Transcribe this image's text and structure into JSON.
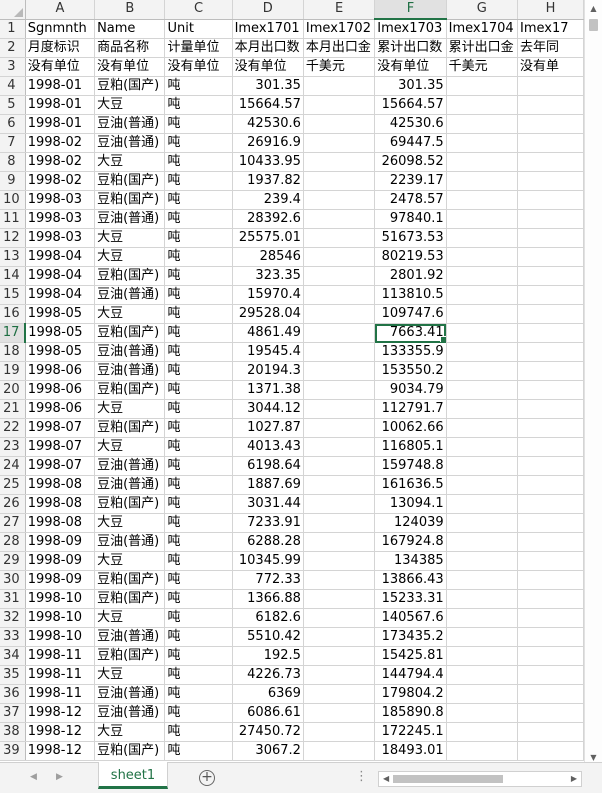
{
  "columns": [
    "A",
    "B",
    "C",
    "D",
    "E",
    "F",
    "G",
    "H"
  ],
  "selected_column": "F",
  "selected_row": 17,
  "active_cell": "F17",
  "rows": [
    {
      "r": 1,
      "A": "Sgnmnth",
      "B": "Name",
      "C": "Unit",
      "D": "Imex1701",
      "E": "Imex1702",
      "F": "Imex1703",
      "G": "Imex1704",
      "H": "Imex17"
    },
    {
      "r": 2,
      "A": "月度标识",
      "B": "商品名称",
      "C": "计量单位",
      "D": "本月出口数",
      "E": "本月出口金",
      "F": "累计出口数",
      "G": "累计出口金",
      "H": "去年同"
    },
    {
      "r": 3,
      "A": "没有单位",
      "B": "没有单位",
      "C": "没有单位",
      "D": "没有单位",
      "E": "千美元",
      "F": "没有单位",
      "G": "千美元",
      "H": "没有单"
    },
    {
      "r": 4,
      "A": "1998-01",
      "B": "豆粕(国产)",
      "C": "吨",
      "D": "301.35",
      "E": "",
      "F": "301.35",
      "G": "",
      "H": ""
    },
    {
      "r": 5,
      "A": "1998-01",
      "B": "大豆",
      "C": "吨",
      "D": "15664.57",
      "E": "",
      "F": "15664.57",
      "G": "",
      "H": ""
    },
    {
      "r": 6,
      "A": "1998-01",
      "B": "豆油(普通)",
      "C": "吨",
      "D": "42530.6",
      "E": "",
      "F": "42530.6",
      "G": "",
      "H": ""
    },
    {
      "r": 7,
      "A": "1998-02",
      "B": "豆油(普通)",
      "C": "吨",
      "D": "26916.9",
      "E": "",
      "F": "69447.5",
      "G": "",
      "H": ""
    },
    {
      "r": 8,
      "A": "1998-02",
      "B": "大豆",
      "C": "吨",
      "D": "10433.95",
      "E": "",
      "F": "26098.52",
      "G": "",
      "H": ""
    },
    {
      "r": 9,
      "A": "1998-02",
      "B": "豆粕(国产)",
      "C": "吨",
      "D": "1937.82",
      "E": "",
      "F": "2239.17",
      "G": "",
      "H": ""
    },
    {
      "r": 10,
      "A": "1998-03",
      "B": "豆粕(国产)",
      "C": "吨",
      "D": "239.4",
      "E": "",
      "F": "2478.57",
      "G": "",
      "H": ""
    },
    {
      "r": 11,
      "A": "1998-03",
      "B": "豆油(普通)",
      "C": "吨",
      "D": "28392.6",
      "E": "",
      "F": "97840.1",
      "G": "",
      "H": ""
    },
    {
      "r": 12,
      "A": "1998-03",
      "B": "大豆",
      "C": "吨",
      "D": "25575.01",
      "E": "",
      "F": "51673.53",
      "G": "",
      "H": ""
    },
    {
      "r": 13,
      "A": "1998-04",
      "B": "大豆",
      "C": "吨",
      "D": "28546",
      "E": "",
      "F": "80219.53",
      "G": "",
      "H": ""
    },
    {
      "r": 14,
      "A": "1998-04",
      "B": "豆粕(国产)",
      "C": "吨",
      "D": "323.35",
      "E": "",
      "F": "2801.92",
      "G": "",
      "H": ""
    },
    {
      "r": 15,
      "A": "1998-04",
      "B": "豆油(普通)",
      "C": "吨",
      "D": "15970.4",
      "E": "",
      "F": "113810.5",
      "G": "",
      "H": ""
    },
    {
      "r": 16,
      "A": "1998-05",
      "B": "大豆",
      "C": "吨",
      "D": "29528.04",
      "E": "",
      "F": "109747.6",
      "G": "",
      "H": ""
    },
    {
      "r": 17,
      "A": "1998-05",
      "B": "豆粕(国产)",
      "C": "吨",
      "D": "4861.49",
      "E": "",
      "F": "7663.41",
      "G": "",
      "H": ""
    },
    {
      "r": 18,
      "A": "1998-05",
      "B": "豆油(普通)",
      "C": "吨",
      "D": "19545.4",
      "E": "",
      "F": "133355.9",
      "G": "",
      "H": ""
    },
    {
      "r": 19,
      "A": "1998-06",
      "B": "豆油(普通)",
      "C": "吨",
      "D": "20194.3",
      "E": "",
      "F": "153550.2",
      "G": "",
      "H": ""
    },
    {
      "r": 20,
      "A": "1998-06",
      "B": "豆粕(国产)",
      "C": "吨",
      "D": "1371.38",
      "E": "",
      "F": "9034.79",
      "G": "",
      "H": ""
    },
    {
      "r": 21,
      "A": "1998-06",
      "B": "大豆",
      "C": "吨",
      "D": "3044.12",
      "E": "",
      "F": "112791.7",
      "G": "",
      "H": ""
    },
    {
      "r": 22,
      "A": "1998-07",
      "B": "豆粕(国产)",
      "C": "吨",
      "D": "1027.87",
      "E": "",
      "F": "10062.66",
      "G": "",
      "H": ""
    },
    {
      "r": 23,
      "A": "1998-07",
      "B": "大豆",
      "C": "吨",
      "D": "4013.43",
      "E": "",
      "F": "116805.1",
      "G": "",
      "H": ""
    },
    {
      "r": 24,
      "A": "1998-07",
      "B": "豆油(普通)",
      "C": "吨",
      "D": "6198.64",
      "E": "",
      "F": "159748.8",
      "G": "",
      "H": ""
    },
    {
      "r": 25,
      "A": "1998-08",
      "B": "豆油(普通)",
      "C": "吨",
      "D": "1887.69",
      "E": "",
      "F": "161636.5",
      "G": "",
      "H": ""
    },
    {
      "r": 26,
      "A": "1998-08",
      "B": "豆粕(国产)",
      "C": "吨",
      "D": "3031.44",
      "E": "",
      "F": "13094.1",
      "G": "",
      "H": ""
    },
    {
      "r": 27,
      "A": "1998-08",
      "B": "大豆",
      "C": "吨",
      "D": "7233.91",
      "E": "",
      "F": "124039",
      "G": "",
      "H": ""
    },
    {
      "r": 28,
      "A": "1998-09",
      "B": "豆油(普通)",
      "C": "吨",
      "D": "6288.28",
      "E": "",
      "F": "167924.8",
      "G": "",
      "H": ""
    },
    {
      "r": 29,
      "A": "1998-09",
      "B": "大豆",
      "C": "吨",
      "D": "10345.99",
      "E": "",
      "F": "134385",
      "G": "",
      "H": ""
    },
    {
      "r": 30,
      "A": "1998-09",
      "B": "豆粕(国产)",
      "C": "吨",
      "D": "772.33",
      "E": "",
      "F": "13866.43",
      "G": "",
      "H": ""
    },
    {
      "r": 31,
      "A": "1998-10",
      "B": "豆粕(国产)",
      "C": "吨",
      "D": "1366.88",
      "E": "",
      "F": "15233.31",
      "G": "",
      "H": ""
    },
    {
      "r": 32,
      "A": "1998-10",
      "B": "大豆",
      "C": "吨",
      "D": "6182.6",
      "E": "",
      "F": "140567.6",
      "G": "",
      "H": ""
    },
    {
      "r": 33,
      "A": "1998-10",
      "B": "豆油(普通)",
      "C": "吨",
      "D": "5510.42",
      "E": "",
      "F": "173435.2",
      "G": "",
      "H": ""
    },
    {
      "r": 34,
      "A": "1998-11",
      "B": "豆粕(国产)",
      "C": "吨",
      "D": "192.5",
      "E": "",
      "F": "15425.81",
      "G": "",
      "H": ""
    },
    {
      "r": 35,
      "A": "1998-11",
      "B": "大豆",
      "C": "吨",
      "D": "4226.73",
      "E": "",
      "F": "144794.4",
      "G": "",
      "H": ""
    },
    {
      "r": 36,
      "A": "1998-11",
      "B": "豆油(普通)",
      "C": "吨",
      "D": "6369",
      "E": "",
      "F": "179804.2",
      "G": "",
      "H": ""
    },
    {
      "r": 37,
      "A": "1998-12",
      "B": "豆油(普通)",
      "C": "吨",
      "D": "6086.61",
      "E": "",
      "F": "185890.8",
      "G": "",
      "H": ""
    },
    {
      "r": 38,
      "A": "1998-12",
      "B": "大豆",
      "C": "吨",
      "D": "27450.72",
      "E": "",
      "F": "172245.1",
      "G": "",
      "H": ""
    },
    {
      "r": 39,
      "A": "1998-12",
      "B": "豆粕(国产)",
      "C": "吨",
      "D": "3067.2",
      "E": "",
      "F": "18493.01",
      "G": "",
      "H": ""
    }
  ],
  "sheet_tab": "sheet1",
  "icons": {
    "prev": "◀",
    "next": "▶",
    "add": "+",
    "split": "⋮",
    "scroll_up": "▲",
    "scroll_down": "▼",
    "scroll_left": "◀",
    "scroll_right": "▶"
  },
  "colors": {
    "accent": "#217346",
    "header_bg": "#f3f3f3",
    "gridline": "#d4d4d4"
  }
}
